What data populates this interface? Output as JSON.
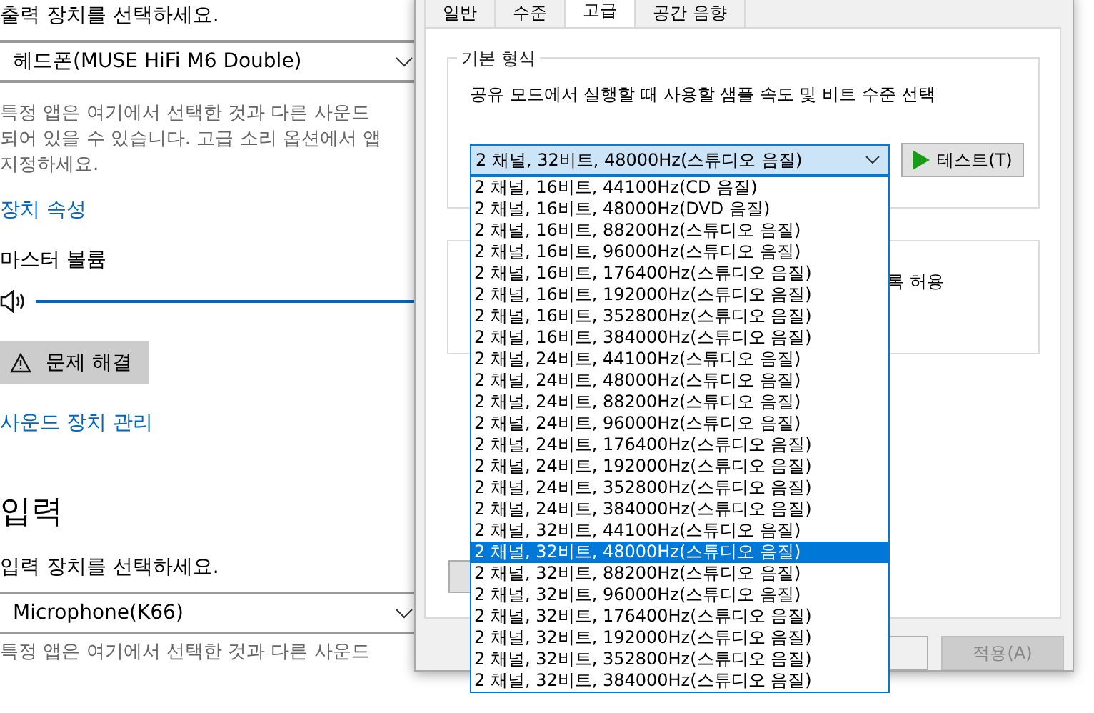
{
  "settings": {
    "output_prompt": "출력 장치를 선택하세요.",
    "output_device": "헤드폰(MUSE HiFi M6 Double)",
    "output_note_lines": [
      "특정 앱은 여기에서 선택한 것과 다른 사운드",
      "되어 있을 수 있습니다. 고급 소리 옵션에서 앱",
      "지정하세요."
    ],
    "device_properties_link": "장치 속성",
    "master_volume_label": "마스터 볼륨",
    "troubleshoot_button": "문제 해결",
    "manage_devices_link": "사운드 장치 관리",
    "input_heading": "입력",
    "input_prompt": "입력 장치를 선택하세요.",
    "input_device": "Microphone(K66)",
    "input_note": "특정 앱은 여기에서 선택한 것과 다른 사운드"
  },
  "dialog": {
    "tabs": [
      {
        "label": "일반",
        "selected": false
      },
      {
        "label": "수준",
        "selected": false
      },
      {
        "label": "고급",
        "selected": true
      },
      {
        "label": "공간 음향",
        "selected": false
      }
    ],
    "default_format": {
      "group_title": "기본 형식",
      "description": "공유 모드에서 실행할 때 사용할 샘플 속도 및 비트 수준 선택",
      "selected_format": "2 채널, 32비트, 48000Hz(스튜디오 음질)",
      "test_button": "테스트(T)",
      "options": [
        {
          "label": "2 채널, 16비트, 44100Hz(CD 음질)",
          "selected": false
        },
        {
          "label": "2 채널, 16비트, 48000Hz(DVD 음질)",
          "selected": false
        },
        {
          "label": "2 채널, 16비트, 88200Hz(스튜디오 음질)",
          "selected": false
        },
        {
          "label": "2 채널, 16비트, 96000Hz(스튜디오 음질)",
          "selected": false
        },
        {
          "label": "2 채널, 16비트, 176400Hz(스튜디오 음질)",
          "selected": false
        },
        {
          "label": "2 채널, 16비트, 192000Hz(스튜디오 음질)",
          "selected": false
        },
        {
          "label": "2 채널, 16비트, 352800Hz(스튜디오 음질)",
          "selected": false
        },
        {
          "label": "2 채널, 16비트, 384000Hz(스튜디오 음질)",
          "selected": false
        },
        {
          "label": "2 채널, 24비트, 44100Hz(스튜디오 음질)",
          "selected": false
        },
        {
          "label": "2 채널, 24비트, 48000Hz(스튜디오 음질)",
          "selected": false
        },
        {
          "label": "2 채널, 24비트, 88200Hz(스튜디오 음질)",
          "selected": false
        },
        {
          "label": "2 채널, 24비트, 96000Hz(스튜디오 음질)",
          "selected": false
        },
        {
          "label": "2 채널, 24비트, 176400Hz(스튜디오 음질)",
          "selected": false
        },
        {
          "label": "2 채널, 24비트, 192000Hz(스튜디오 음질)",
          "selected": false
        },
        {
          "label": "2 채널, 24비트, 352800Hz(스튜디오 음질)",
          "selected": false
        },
        {
          "label": "2 채널, 24비트, 384000Hz(스튜디오 음질)",
          "selected": false
        },
        {
          "label": "2 채널, 32비트, 44100Hz(스튜디오 음질)",
          "selected": false
        },
        {
          "label": "2 채널, 32비트, 48000Hz(스튜디오 음질)",
          "selected": true
        },
        {
          "label": "2 채널, 32비트, 88200Hz(스튜디오 음질)",
          "selected": false
        },
        {
          "label": "2 채널, 32비트, 96000Hz(스튜디오 음질)",
          "selected": false
        },
        {
          "label": "2 채널, 32비트, 176400Hz(스튜디오 음질)",
          "selected": false
        },
        {
          "label": "2 채널, 32비트, 192000Hz(스튜디오 음질)",
          "selected": false
        },
        {
          "label": "2 채널, 32비트, 352800Hz(스튜디오 음질)",
          "selected": false
        },
        {
          "label": "2 채널, 32비트, 384000Hz(스튜디오 음질)",
          "selected": false
        }
      ]
    },
    "exclusive_option_fragment": "록 허용",
    "apply_button": {
      "label": "적용(A)",
      "disabled": true
    }
  }
}
